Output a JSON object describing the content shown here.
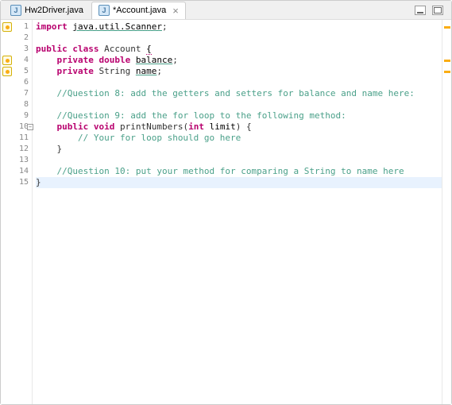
{
  "tabs": [
    {
      "label": "Hw2Driver.java",
      "active": false
    },
    {
      "label": "*Account.java",
      "active": true
    }
  ],
  "gutter": {
    "lines": [
      "1",
      "2",
      "3",
      "4",
      "5",
      "6",
      "7",
      "8",
      "9",
      "10",
      "11",
      "12",
      "13",
      "14",
      "15"
    ],
    "foldable": [
      10
    ]
  },
  "markers": {
    "left": [
      1,
      4,
      5
    ],
    "right": [
      1,
      4,
      5
    ]
  },
  "code": {
    "l1_import": "import",
    "l1_pkg": "java.util.Scanner",
    "l1_semi": ";",
    "l3_public": "public",
    "l3_class": "class",
    "l3_name": "Account",
    "l3_brace": "{",
    "l4_private": "private",
    "l4_type": "double",
    "l4_name": "balance",
    "l4_semi": ";",
    "l5_private": "private",
    "l5_type": "String",
    "l5_name": "name",
    "l5_semi": ";",
    "l7_comment": "//Question 8: add the getters and setters for balance and name here:",
    "l9_comment": "//Question 9: add the for loop to the following method:",
    "l10_public": "public",
    "l10_void": "void",
    "l10_method": "printNumbers",
    "l10_paren_o": "(",
    "l10_int": "int",
    "l10_param": " limit",
    "l10_paren_c": ")",
    "l10_brace": " {",
    "l11_comment": "// Your for loop should go here",
    "l12_brace": "}",
    "l14_comment": "//Question 10: put your method for comparing a String to name here",
    "l15_brace": "}"
  },
  "current_line": 15
}
